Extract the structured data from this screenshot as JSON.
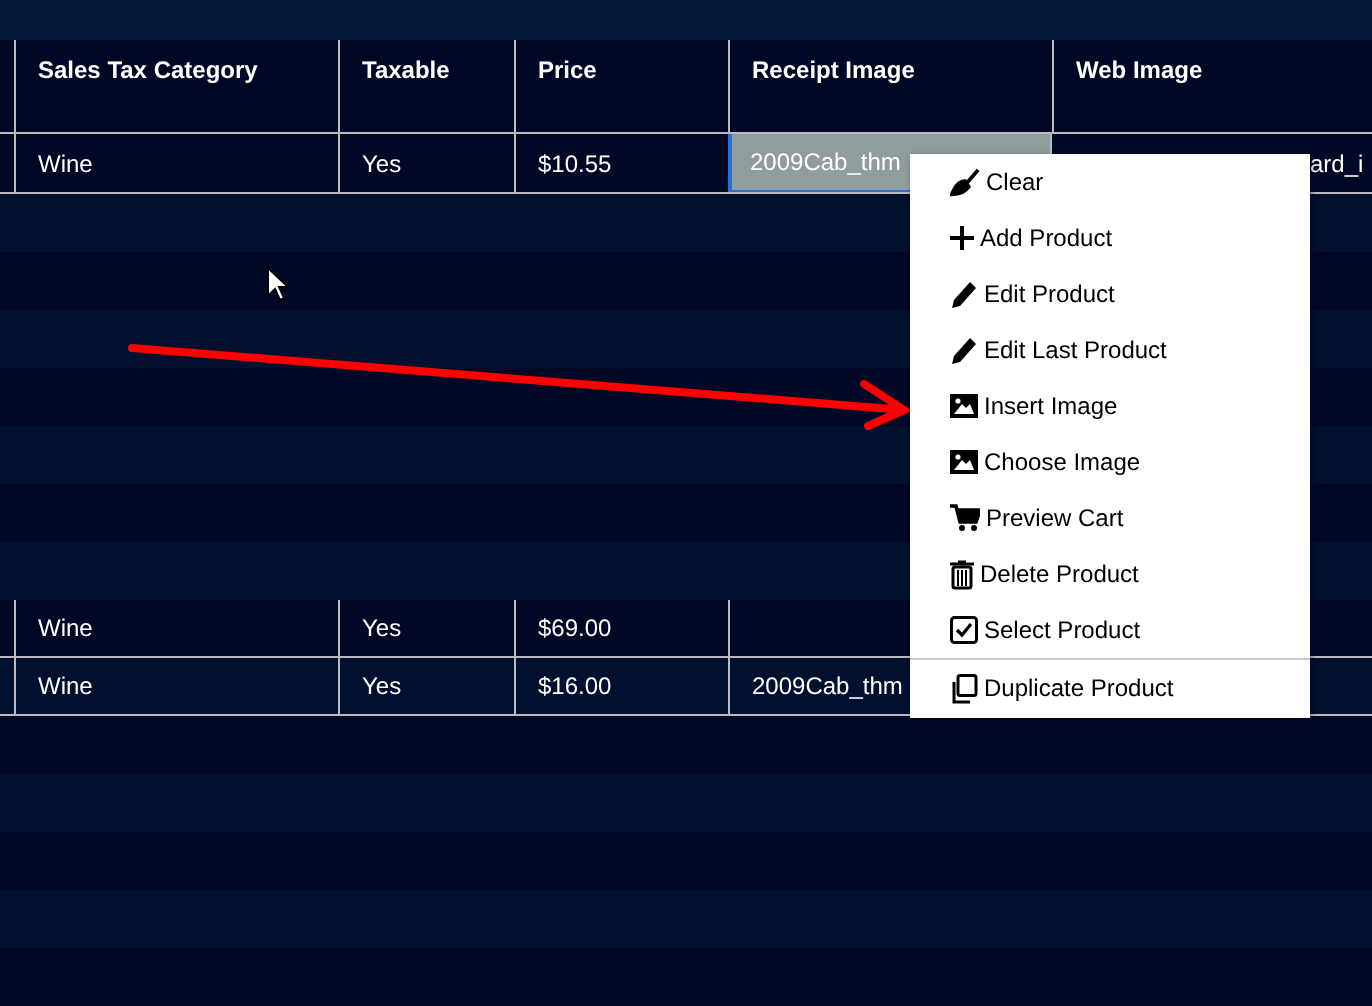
{
  "table": {
    "columns": [
      "Sales Tax Category",
      "Taxable",
      "Price",
      "Receipt Image",
      "Web Image"
    ],
    "rows": [
      {
        "kind": "data",
        "sales_tax_category": "Wine",
        "taxable": "Yes",
        "price": "$10.55",
        "receipt_image": "2009Cab_thm",
        "web_image": "ard_i",
        "receipt_selected": true
      },
      {
        "kind": "empty"
      },
      {
        "kind": "empty"
      },
      {
        "kind": "empty"
      },
      {
        "kind": "empty"
      },
      {
        "kind": "empty"
      },
      {
        "kind": "empty"
      },
      {
        "kind": "empty"
      },
      {
        "kind": "data",
        "sales_tax_category": "Wine",
        "taxable": "Yes",
        "price": "$69.00",
        "receipt_selected": false
      },
      {
        "kind": "data",
        "sales_tax_category": "Wine",
        "taxable": "Yes",
        "price": "$16.00",
        "receipt_image": "2009Cab_thm",
        "receipt_selected": false
      },
      {
        "kind": "empty"
      },
      {
        "kind": "empty"
      },
      {
        "kind": "empty"
      },
      {
        "kind": "empty"
      },
      {
        "kind": "empty"
      }
    ]
  },
  "context_menu": {
    "items": [
      {
        "kind": "broom",
        "label": "Clear"
      },
      {
        "kind": "plus",
        "label": "Add Product"
      },
      {
        "kind": "pencil",
        "label": "Edit Product"
      },
      {
        "kind": "pencil",
        "label": "Edit Last Product"
      },
      {
        "kind": "image",
        "label": "Insert Image"
      },
      {
        "kind": "image",
        "label": "Choose Image"
      },
      {
        "kind": "cart",
        "label": "Preview Cart"
      },
      {
        "kind": "trash",
        "label": "Delete Product"
      },
      {
        "kind": "checkbox",
        "label": "Select Product"
      },
      {
        "kind": "copy",
        "label": "Duplicate Product",
        "separator_before": true
      }
    ]
  }
}
